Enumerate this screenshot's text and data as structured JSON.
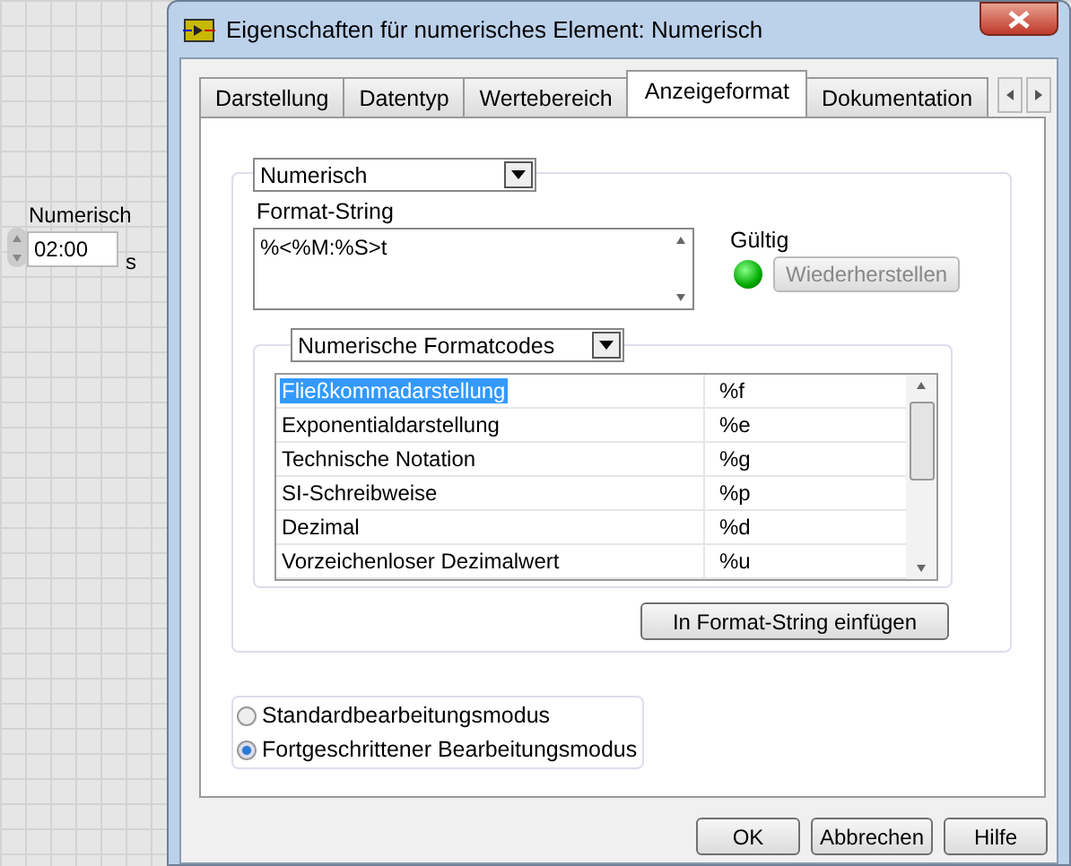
{
  "front_panel": {
    "control_label": "Numerisch",
    "control_value": "02:00",
    "unit": "s"
  },
  "window": {
    "title": "Eigenschaften für numerisches Element: Numerisch"
  },
  "tabs": [
    {
      "label": "Darstellung",
      "selected": false
    },
    {
      "label": "Datentyp",
      "selected": false
    },
    {
      "label": "Wertebereich",
      "selected": false
    },
    {
      "label": "Anzeigeformat",
      "selected": true
    },
    {
      "label": "Dokumentation",
      "selected": false
    }
  ],
  "format_type": "Numerisch",
  "format_string": {
    "label": "Format-String",
    "value": "%<%M:%S>t"
  },
  "validity": {
    "label": "Gültig",
    "valid": true,
    "restore_button": "Wiederherstellen",
    "restore_disabled": true
  },
  "codes": {
    "category": "Numerische Formatcodes",
    "rows": [
      {
        "name": "Fließkommadarstellung",
        "code": "%f",
        "selected": true
      },
      {
        "name": "Exponentialdarstellung",
        "code": "%e",
        "selected": false
      },
      {
        "name": "Technische Notation",
        "code": "%g",
        "selected": false
      },
      {
        "name": "SI-Schreibweise",
        "code": "%p",
        "selected": false
      },
      {
        "name": "Dezimal",
        "code": "%d",
        "selected": false
      },
      {
        "name": "Vorzeichenloser Dezimalwert",
        "code": "%u",
        "selected": false
      }
    ],
    "insert_button": "In Format-String einfügen"
  },
  "modes": [
    {
      "label": "Standardbearbeitungsmodus",
      "selected": false
    },
    {
      "label": "Fortgeschrittener Bearbeitungsmodus",
      "selected": true
    }
  ],
  "buttons": [
    "OK",
    "Abbrechen",
    "Hilfe"
  ]
}
